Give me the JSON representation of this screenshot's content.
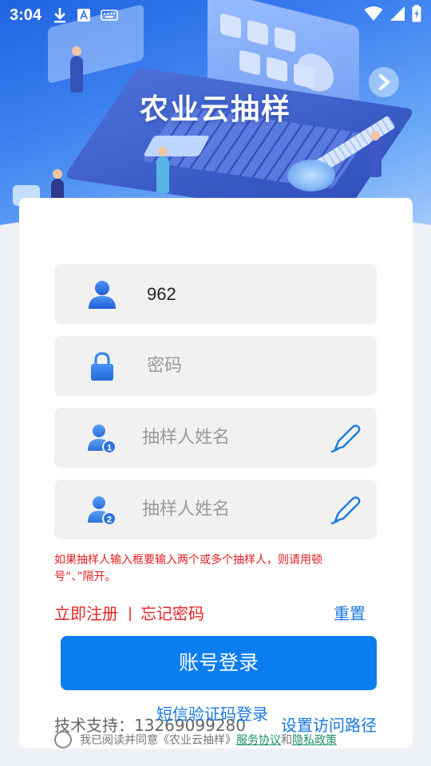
{
  "status_bar": {
    "time": "3:04",
    "icons": [
      "download-icon",
      "text-a-icon",
      "keyboard-icon",
      "wifi-icon",
      "signal-icon",
      "battery-charging-icon"
    ]
  },
  "header": {
    "title": "农业云抽样"
  },
  "form": {
    "account": {
      "value": "962",
      "icon": "user-icon"
    },
    "password": {
      "placeholder": "密码",
      "icon": "lock-icon"
    },
    "sampler1": {
      "placeholder": "抽样人姓名",
      "icon": "user-1-icon",
      "action_icon": "pen-icon"
    },
    "sampler2": {
      "placeholder": "抽样人姓名",
      "icon": "user-2-icon",
      "action_icon": "pen-icon"
    },
    "hint": "如果抽样人输入框要输入两个或多个抽样人，则请用顿号“、”隔开。"
  },
  "links": {
    "register": "立即注册",
    "separator": "|",
    "forgot": "忘记密码",
    "reset": "重置"
  },
  "buttons": {
    "login": "账号登录",
    "sms_login": "短信验证码登录",
    "set_path": "设置访问路径"
  },
  "footer": {
    "support": "技术支持：13269099280",
    "agree_prefix": "我已阅读并同意《农业云抽样》",
    "service": "服务协议",
    "and": "和",
    "privacy": "隐私政策"
  },
  "colors": {
    "primary": "#0a7df0",
    "link_blue": "#1a7ae0",
    "hint_red": "#e02020",
    "link_red": "#e32424",
    "agree_link": "#1e8f6a"
  }
}
